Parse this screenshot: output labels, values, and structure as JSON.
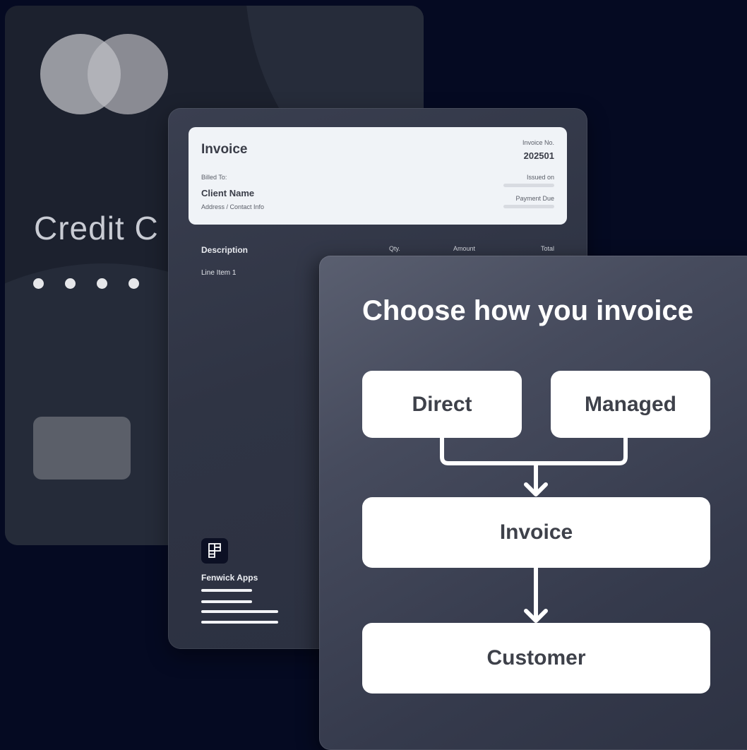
{
  "card": {
    "title": "Credit C"
  },
  "invoice": {
    "title": "Invoice",
    "billed_to_label": "Billed To:",
    "client_name": "Client Name",
    "address": "Address / Contact Info",
    "invoice_no_label": "Invoice No.",
    "invoice_no": "202501",
    "issued_on_label": "Issued on",
    "payment_due_label": "Payment Due",
    "columns": {
      "description": "Description",
      "qty": "Qty.",
      "amount": "Amount",
      "total": "Total"
    },
    "line_items": [
      "Line Item 1"
    ],
    "brand": {
      "name": "Fenwick Apps",
      "logo_icon": "fenwick-logo-icon"
    }
  },
  "flow": {
    "title": "Choose how you invoice",
    "option_direct": "Direct",
    "option_managed": "Managed",
    "step_invoice": "Invoice",
    "step_customer": "Customer"
  },
  "colors": {
    "background": "#050a22",
    "card": "#1c212e",
    "invoice_header": "#f0f3f7",
    "flow_box": "#ffffff",
    "flow_box_text": "#3e414a"
  }
}
